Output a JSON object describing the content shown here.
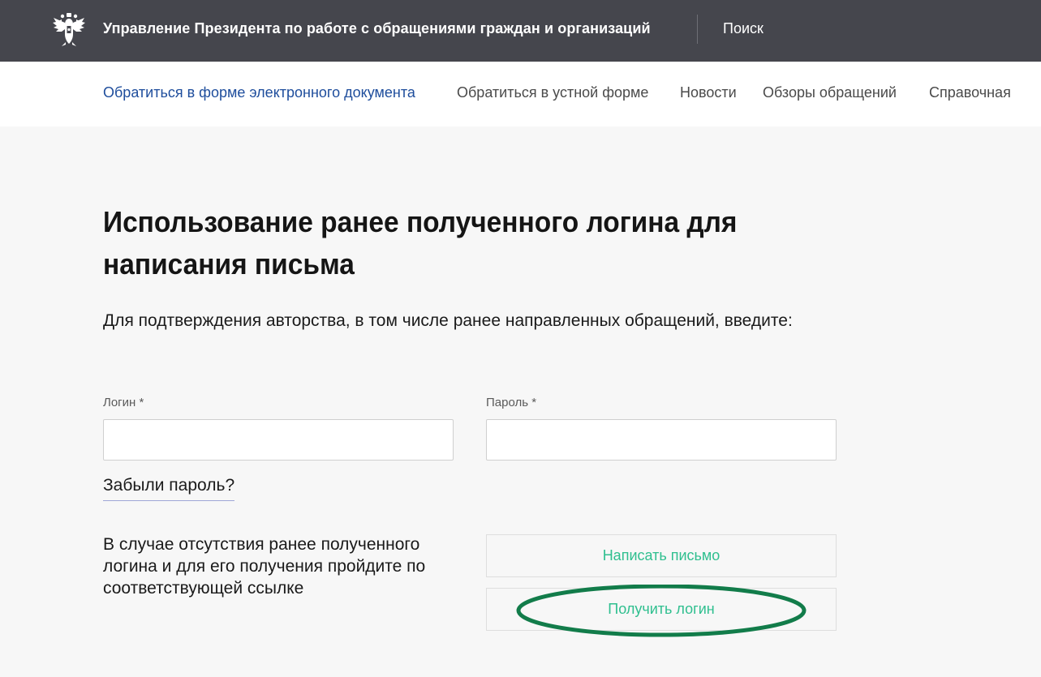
{
  "header": {
    "org_title": "Управление Президента по работе с обращениями граждан и организаций",
    "search_label": "Поиск",
    "emblem_icon": "double-headed-eagle-icon",
    "background_color": "#45464d"
  },
  "nav": {
    "items": [
      {
        "label": "Обратиться в форме электронного документа",
        "active": true
      },
      {
        "label": "Обратиться в устной форме",
        "active": false
      },
      {
        "label": "Новости",
        "active": false
      },
      {
        "label": "Обзоры обращений",
        "active": false
      },
      {
        "label": "Справочная",
        "active": false
      }
    ],
    "active_color": "#1e4d9c"
  },
  "main": {
    "title": "Использование ранее полученного логина для написания письма",
    "intro": "Для подтверждения авторства, в том числе ранее направленных обращений, введите:",
    "login_label": "Логин *",
    "login_value": "",
    "password_label": "Пароль *",
    "password_value": "",
    "forgot_password": "Забыли пароль?",
    "notice": "В случае отсутствия ранее полученного логина и для его получения пройдите по соответствующей ссылке",
    "write_letter_button": "Написать письмо",
    "get_login_button": "Получить логин",
    "button_text_color": "#2fbf8f",
    "highlight_color": "#127c4a"
  }
}
